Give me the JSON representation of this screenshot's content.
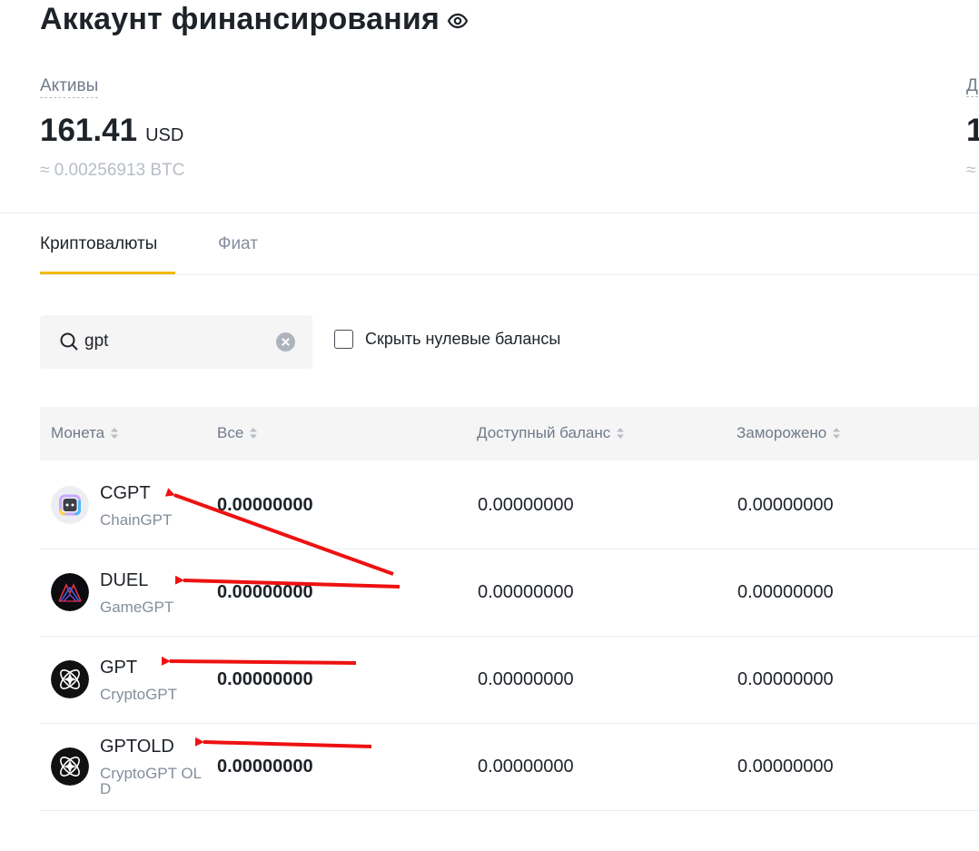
{
  "header": {
    "title": "Аккаунт финансирования",
    "visibility_icon": "eye-icon"
  },
  "assets": {
    "label": "Активы",
    "amount": "161.41",
    "currency": "USD",
    "btc_equiv": "≈ 0.00256913 BTC"
  },
  "right_panel": {
    "label_partial": "Д",
    "value_partial": "1",
    "approx_partial": "≈"
  },
  "tabs": [
    {
      "label": "Криптовалюты",
      "active": true
    },
    {
      "label": "Фиат",
      "active": false
    }
  ],
  "search": {
    "value": "gpt",
    "placeholder": "",
    "icon": "search-icon",
    "clear_icon": "clear-icon"
  },
  "filter": {
    "hide_zero_label": "Скрыть нулевые балансы",
    "checked": false
  },
  "table": {
    "columns": [
      "Монета",
      "Все",
      "Доступный баланс",
      "Заморожено"
    ],
    "rows": [
      {
        "symbol": "CGPT",
        "name": "ChainGPT",
        "total": "0.00000000",
        "available": "0.00000000",
        "frozen": "0.00000000",
        "logo": "chaingpt-logo"
      },
      {
        "symbol": "DUEL",
        "name": "GameGPT",
        "total": "0.00000000",
        "available": "0.00000000",
        "frozen": "0.00000000",
        "logo": "gamegpt-logo"
      },
      {
        "symbol": "GPT",
        "name": "CryptoGPT",
        "total": "0.00000000",
        "available": "0.00000000",
        "frozen": "0.00000000",
        "logo": "cryptogpt-logo"
      },
      {
        "symbol": "GPTOLD",
        "name": "CryptoGPT OLD",
        "total": "0.00000000",
        "available": "0.00000000",
        "frozen": "0.00000000",
        "logo": "cryptogpt-logo"
      }
    ]
  },
  "colors": {
    "accent": "#f0b90b",
    "annotation_arrow": "#ee1111",
    "text_primary": "#1e2329",
    "text_secondary": "#707a8a"
  }
}
